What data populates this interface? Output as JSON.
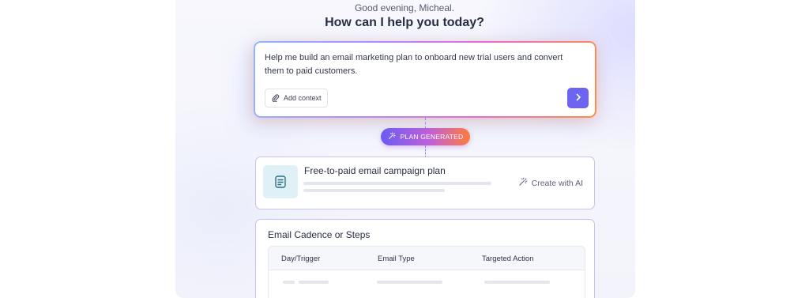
{
  "greeting": "Good evening, Micheal.",
  "headline": "How can I help you today?",
  "prompt": {
    "text": "Help me build an email marketing plan to onboard new trial users and convert them to paid customers.",
    "add_context_label": "Add context",
    "add_context_icon": "paperclip-icon",
    "send_icon": "chevron-right-icon"
  },
  "status_badge": {
    "label": "PLAN GENERATED",
    "icon": "magic-wand-icon"
  },
  "plan_card": {
    "icon": "document-icon",
    "title": "Free-to-paid email campaign plan",
    "action_label": "Create with AI",
    "action_icon": "magic-wand-icon"
  },
  "cadence_card": {
    "title": "Email Cadence or Steps",
    "columns": [
      "Day/Trigger",
      "Email Type",
      "Targeted Action"
    ]
  },
  "colors": {
    "accent": "#6d64f2",
    "gradient_start": "#6b5cf4",
    "gradient_mid": "#c060d8",
    "gradient_end": "#ff7b3c",
    "card_border": "#c8c2f0",
    "doc_tile": "#dff1f6"
  }
}
